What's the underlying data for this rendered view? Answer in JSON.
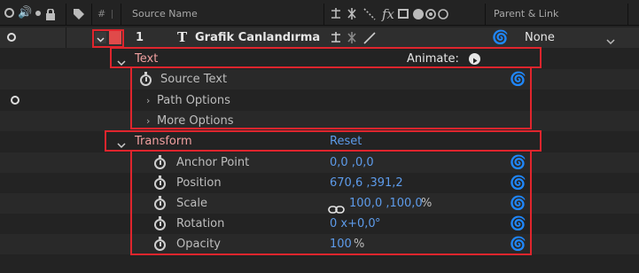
{
  "header": {
    "hash": "#",
    "source_name": "Source Name",
    "parent_link": "Parent & Link"
  },
  "layer": {
    "number": "1",
    "type_glyph": "T",
    "name": "Grafik Canlandırma",
    "parent_value": "None"
  },
  "text_group": {
    "label": "Text",
    "animate_label": "Animate:",
    "items": [
      {
        "label": "Source Text"
      },
      {
        "label": "Path Options"
      },
      {
        "label": "More Options"
      }
    ]
  },
  "transform_group": {
    "label": "Transform",
    "reset_label": "Reset",
    "properties": [
      {
        "label": "Anchor Point",
        "value": "0,0 ,0,0"
      },
      {
        "label": "Position",
        "value": "670,6 ,391,2"
      },
      {
        "label": "Scale",
        "value": "100,0 ,100,0",
        "unit": "%"
      },
      {
        "label": "Rotation",
        "value": "0 x+0,0",
        "unit": "°"
      },
      {
        "label": "Opacity",
        "value": "100",
        "unit": "%"
      }
    ]
  },
  "colors": {
    "highlight_red": "#e0252d",
    "value_blue": "#5d9bea",
    "label_color": "#f0a0a0"
  }
}
